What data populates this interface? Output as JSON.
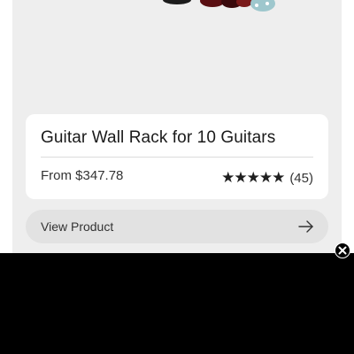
{
  "product": {
    "title": "Guitar Wall Rack for 10 Guitars",
    "price": "From $347.78",
    "stars": "★★★★★",
    "review_count": "(45)",
    "rating_value": 5
  },
  "actions": {
    "view_product_label": "View Product"
  },
  "icons": {
    "arrow": "arrow-right-icon",
    "close": "close-icon"
  },
  "colors": {
    "card_background": "#eeeeee",
    "button_background": "#e2e2e2",
    "overlay": "#000000"
  }
}
